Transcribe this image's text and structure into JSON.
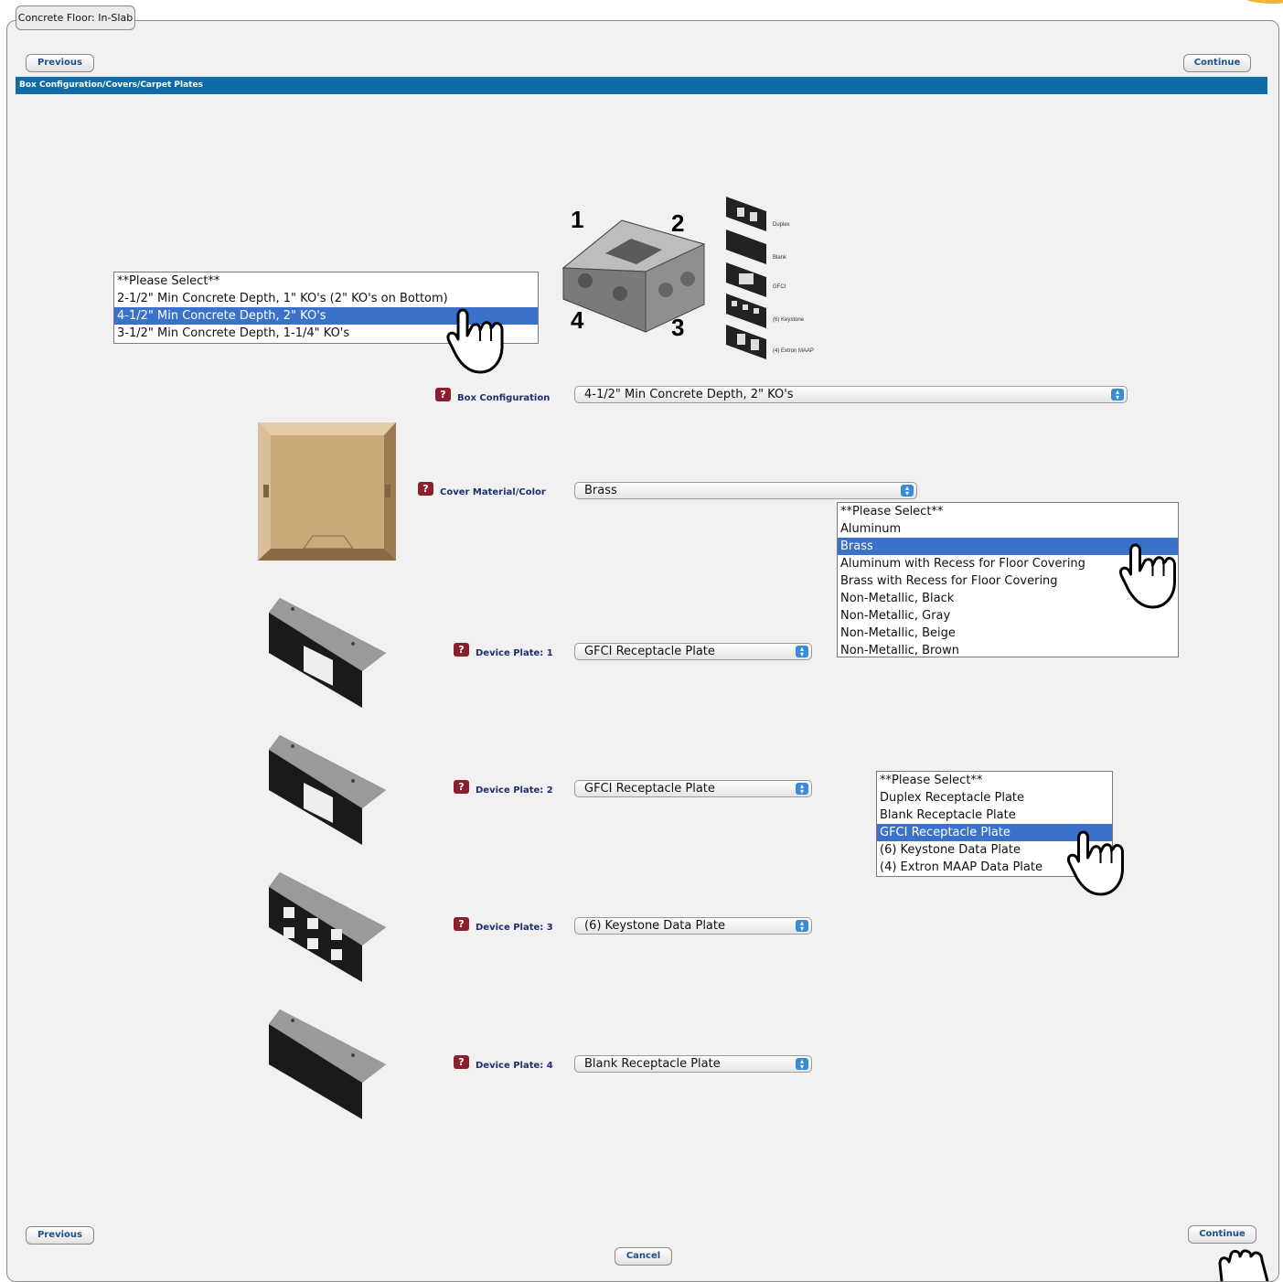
{
  "tab": {
    "label": "Concrete Floor: In-Slab"
  },
  "nav": {
    "previous_label": "Previous",
    "continue_label": "Continue",
    "cancel_label": "Cancel"
  },
  "section": {
    "title": "Box Configuration/Covers/Carpet Plates"
  },
  "box_diagram": {
    "corner_labels": [
      "1",
      "2",
      "3",
      "4"
    ],
    "legend": [
      "Duplex",
      "Blank",
      "GFCI",
      "(6) Keystone",
      "(4) Extron MAAP"
    ]
  },
  "help_icon": "?",
  "box_configuration": {
    "label": "Box Configuration",
    "value": "4-1/2\" Min Concrete Depth, 2\" KO's",
    "options": [
      "**Please Select**",
      "2-1/2\" Min Concrete Depth, 1\" KO's (2\" KO's on Bottom)",
      "4-1/2\" Min Concrete Depth, 2\" KO's",
      "3-1/2\" Min Concrete Depth, 1-1/4\" KO's"
    ],
    "selected_index": 2
  },
  "cover_material": {
    "label": "Cover Material/Color",
    "value": "Brass",
    "options": [
      "**Please Select**",
      "Aluminum",
      "Brass",
      "Aluminum with Recess for Floor Covering",
      "Brass with Recess for Floor Covering",
      "Non-Metallic, Black",
      "Non-Metallic, Gray",
      "Non-Metallic, Beige",
      "Non-Metallic, Brown"
    ],
    "selected_index": 2
  },
  "device_plates": [
    {
      "label": "Device Plate: 1",
      "value": "GFCI Receptacle Plate"
    },
    {
      "label": "Device Plate: 2",
      "value": "GFCI Receptacle Plate"
    },
    {
      "label": "Device Plate: 3",
      "value": "(6) Keystone Data Plate"
    },
    {
      "label": "Device Plate: 4",
      "value": "Blank Receptacle Plate"
    }
  ],
  "device_plate_options": {
    "options": [
      "**Please Select**",
      "Duplex Receptacle Plate",
      "Blank Receptacle Plate",
      "GFCI Receptacle Plate",
      "(6) Keystone Data Plate",
      "(4) Extron MAAP Data Plate"
    ],
    "selected_index": 3
  },
  "colors": {
    "section_bar": "#106ba6",
    "label_text": "#1d2f6e",
    "help_icon": "#8b1f2d",
    "selection": "#3b72c9",
    "brass_cover": "#c9a87a"
  },
  "icons": {
    "help": "question-icon",
    "pointer": "hand-pointer-icon",
    "select_arrows": "select-arrows-icon"
  }
}
